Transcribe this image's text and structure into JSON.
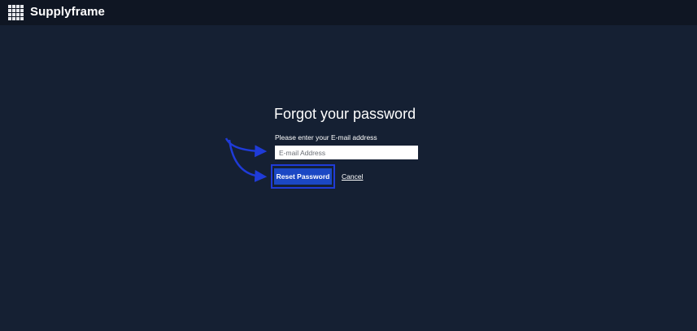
{
  "header": {
    "brand": "Supplyframe",
    "logo_icon": "grid-logo-icon"
  },
  "form": {
    "title": "Forgot your password",
    "email_label": "Please enter your E-mail address",
    "email_placeholder": "E-mail Address",
    "email_value": "",
    "reset_label": "Reset Password",
    "cancel_label": "Cancel"
  },
  "colors": {
    "background": "#152033",
    "topbar": "#0f1623",
    "primary_button": "#1b48c4",
    "annotation": "#1f3bd8"
  },
  "annotations": {
    "arrow_icon": "curved-arrow-icon",
    "highlight": "reset-button-highlight"
  }
}
